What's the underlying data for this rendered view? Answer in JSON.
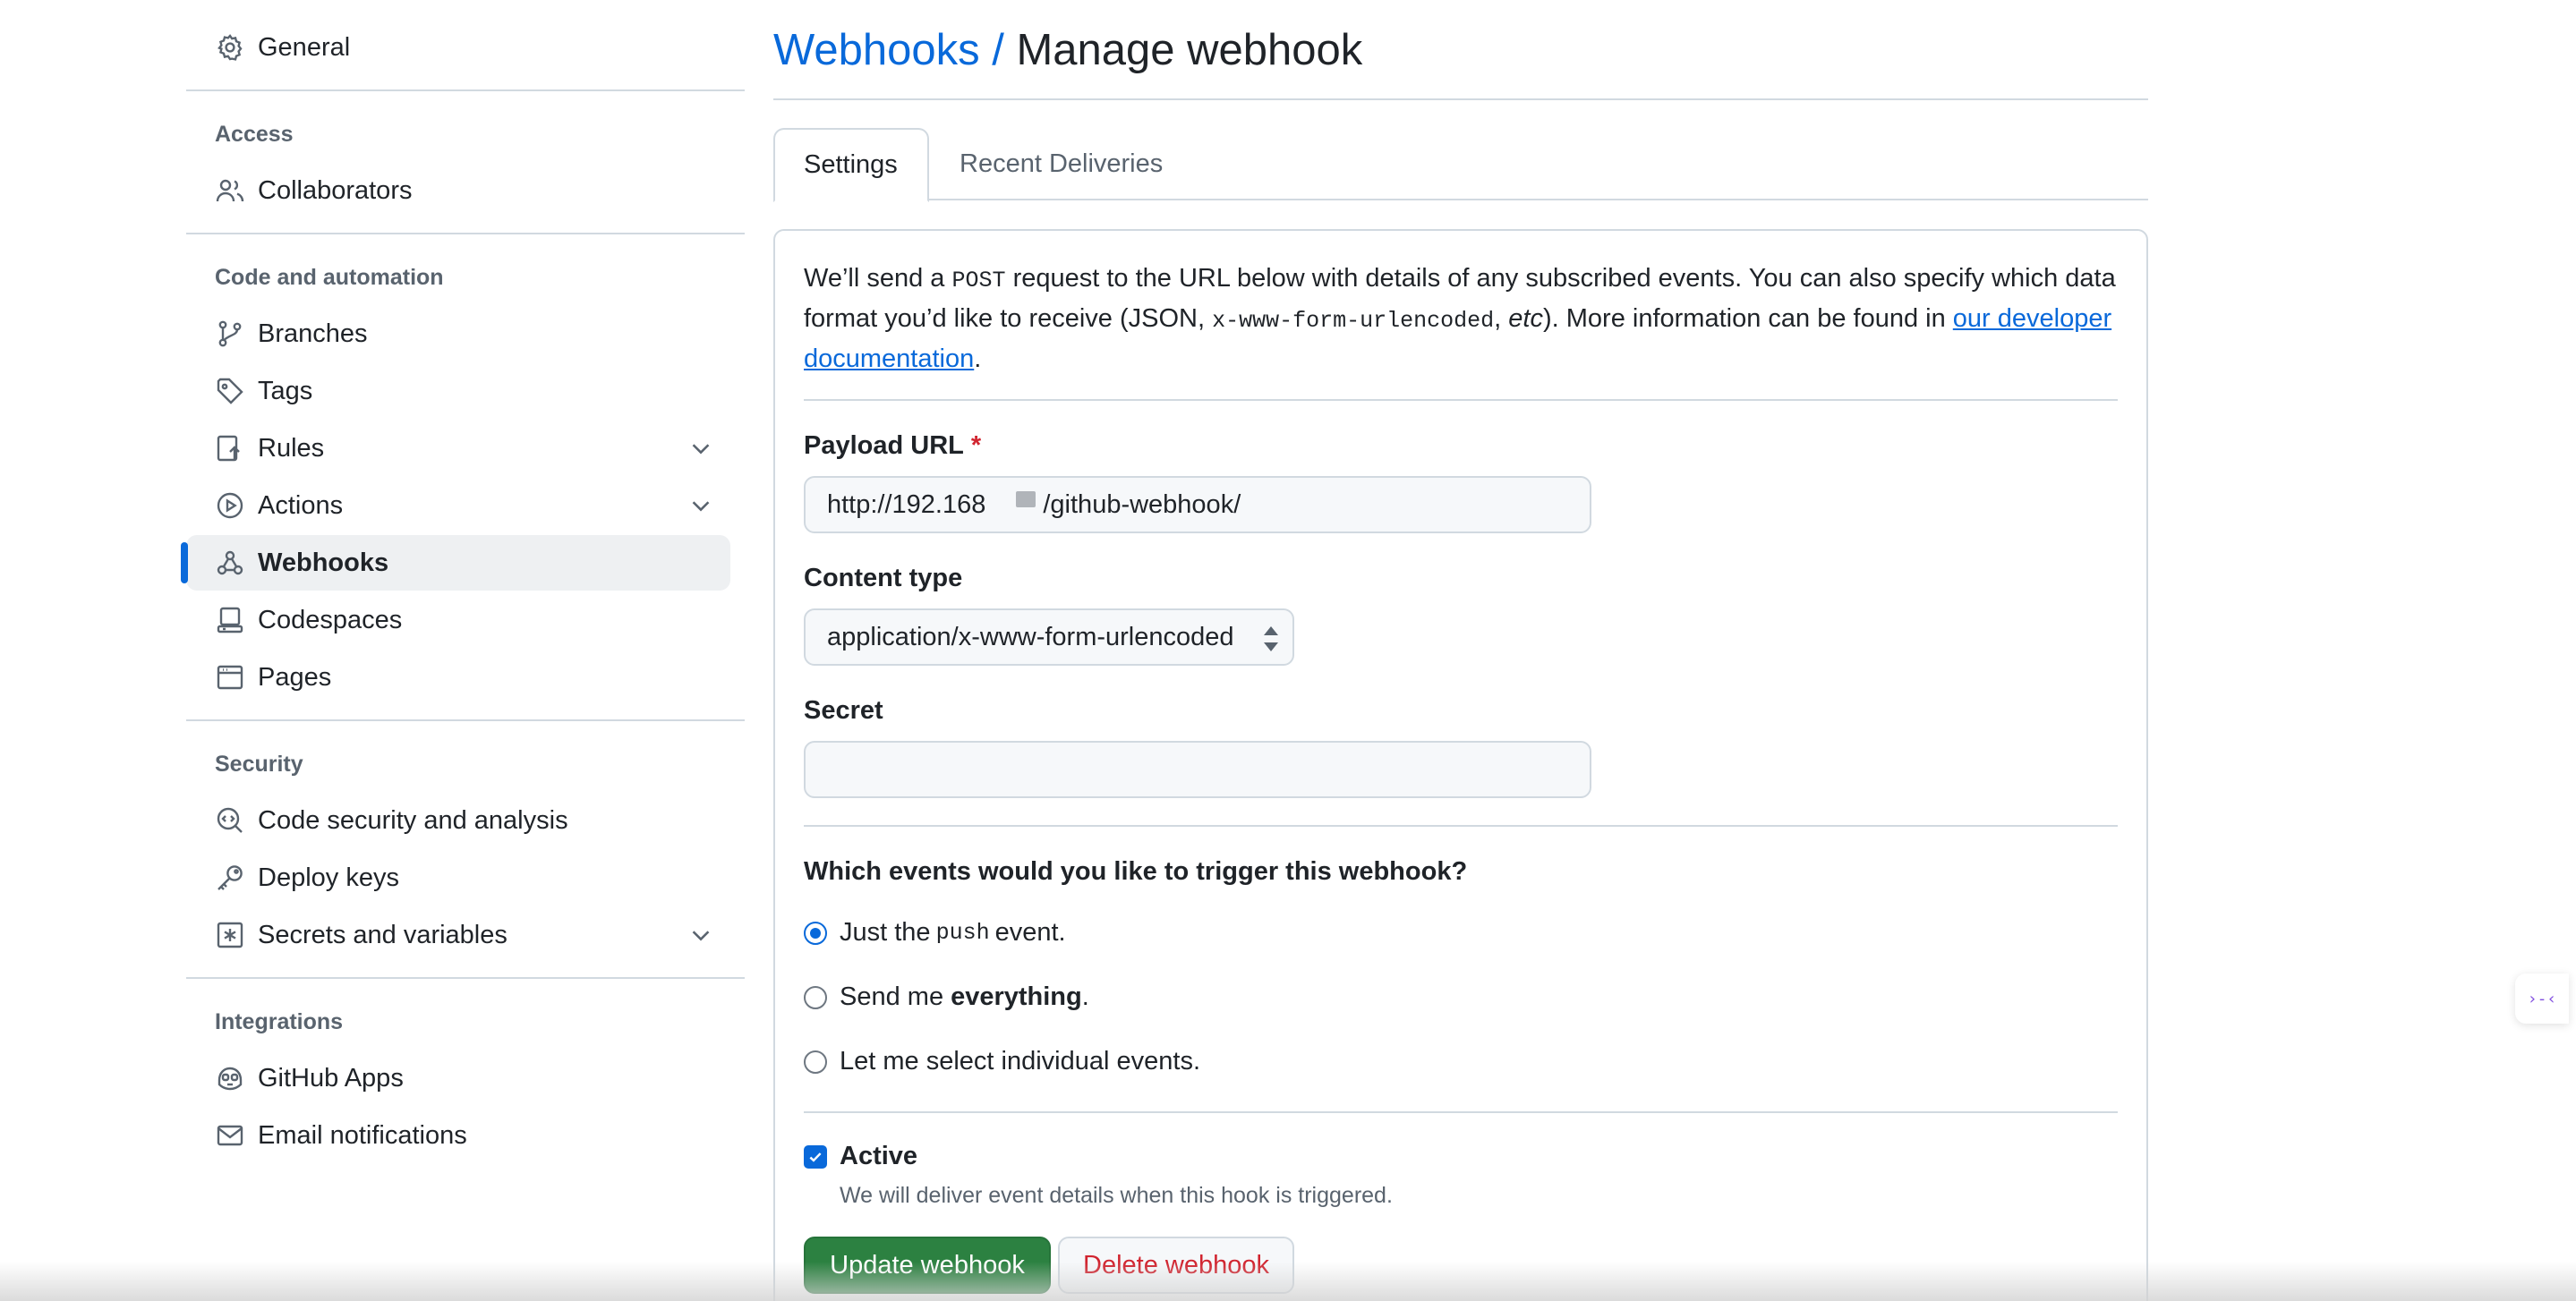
{
  "sidebar": {
    "items_top": [
      {
        "label": "General",
        "icon": "gear-icon"
      }
    ],
    "sections": [
      {
        "heading": "Access",
        "items": [
          {
            "label": "Collaborators",
            "icon": "people-icon"
          }
        ]
      },
      {
        "heading": "Code and automation",
        "items": [
          {
            "label": "Branches",
            "icon": "branch-icon"
          },
          {
            "label": "Tags",
            "icon": "tag-icon"
          },
          {
            "label": "Rules",
            "icon": "rules-icon"
          },
          {
            "label": "Actions",
            "icon": "play-icon"
          },
          {
            "label": "Webhooks",
            "icon": "webhook-icon",
            "active": true
          },
          {
            "label": "Codespaces",
            "icon": "codespaces-icon"
          },
          {
            "label": "Pages",
            "icon": "browser-icon"
          }
        ]
      },
      {
        "heading": "Security",
        "items": [
          {
            "label": "Code security and analysis",
            "icon": "codescan-icon"
          },
          {
            "label": "Deploy keys",
            "icon": "key-icon"
          },
          {
            "label": "Secrets and variables",
            "icon": "asterisk-icon"
          }
        ]
      },
      {
        "heading": "Integrations",
        "items": [
          {
            "label": "GitHub Apps",
            "icon": "copilot-icon"
          },
          {
            "label": "Email notifications",
            "icon": "mail-icon"
          }
        ]
      }
    ]
  },
  "header": {
    "breadcrumb": "Webhooks",
    "separator": " / ",
    "title": "Manage webhook"
  },
  "tabs": {
    "settings": "Settings",
    "recent": "Recent Deliveries"
  },
  "intro": {
    "p1": "We’ll send a ",
    "post": "POST",
    "p2": " request to the URL below with details of any subscribed events. You can also specify which data format you’d like to receive (JSON, ",
    "encoding": "x-www-form-urlencoded",
    "p3": ", ",
    "etc": "etc",
    "p4": "). More information can be found in ",
    "link": "our developer documentation",
    "p5": "."
  },
  "form": {
    "payload_label": "Payload URL",
    "required_mark": "*",
    "payload_value_start": "http://192.168",
    "payload_value_end": "/github-webhook/",
    "content_type_label": "Content type",
    "content_type_value": "application/x-www-form-urlencoded",
    "secret_label": "Secret",
    "secret_value": ""
  },
  "events": {
    "question": "Which events would you like to trigger this webhook?",
    "opt1_a": "Just the ",
    "opt1_code": "push",
    "opt1_b": " event.",
    "opt2_a": "Send me ",
    "opt2_bold": "everything",
    "opt2_b": ".",
    "opt3": "Let me select individual events.",
    "selected": "push"
  },
  "active": {
    "label": "Active",
    "checked": true,
    "note": "We will deliver event details when this hook is triggered."
  },
  "buttons": {
    "update": "Update webhook",
    "delete": "Delete webhook"
  },
  "float": {
    "glyph": "›-‹"
  },
  "colors": {
    "accent": "#0969da",
    "primary_button": "#2c8141",
    "danger_text": "#d1242f"
  }
}
